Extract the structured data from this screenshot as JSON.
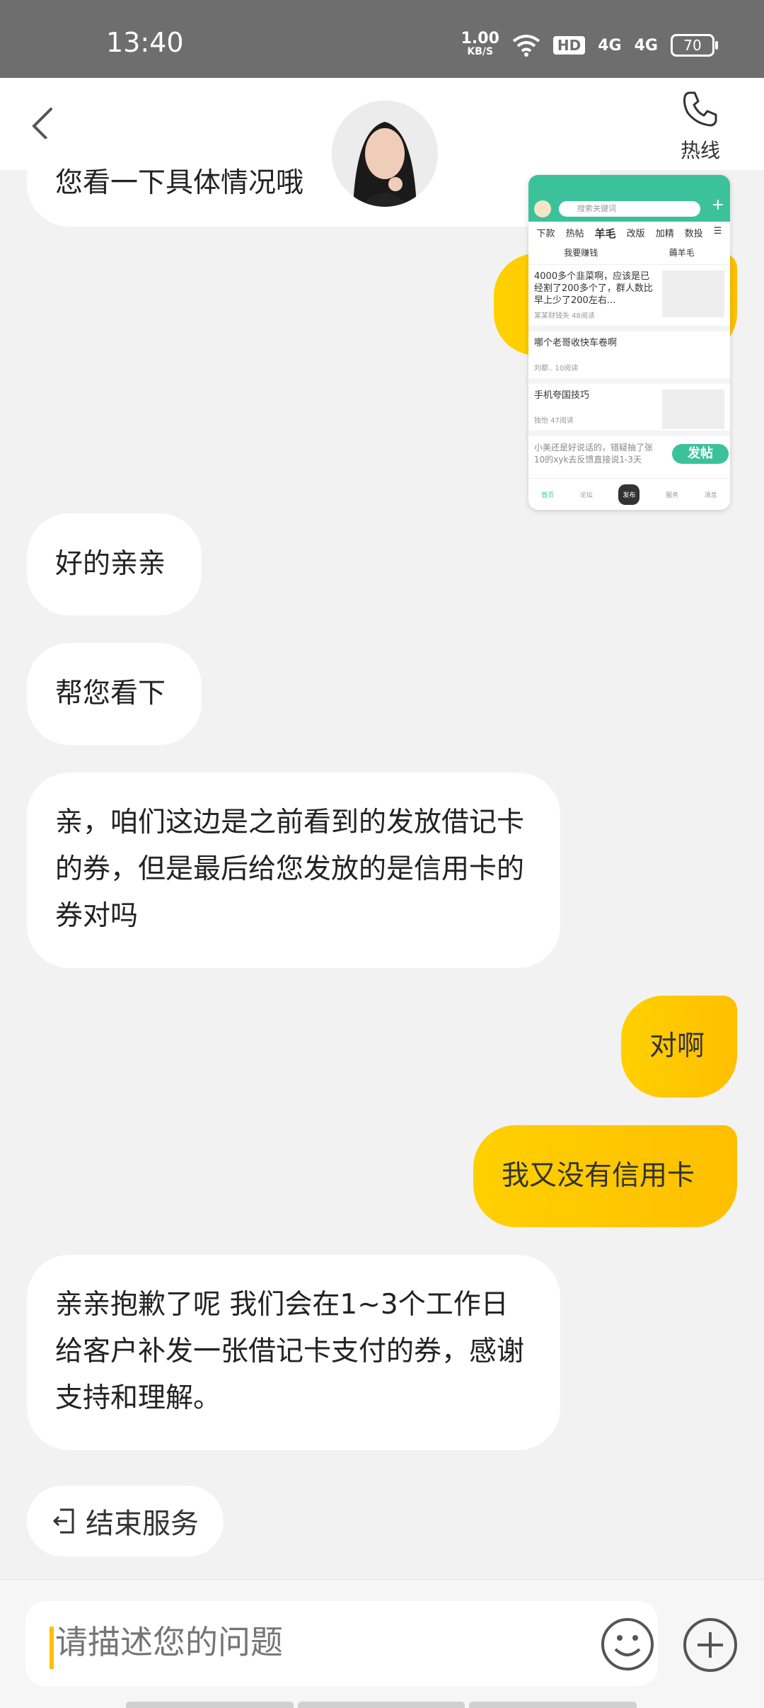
{
  "status_bar": {
    "time": "13:40",
    "net_speed": "1.00",
    "net_unit": "KB/S",
    "hd": "HD",
    "sig1": "4G",
    "sig2": "4G",
    "battery": "70"
  },
  "header": {
    "hotline_label": "热线"
  },
  "messages": [
    {
      "side": "left",
      "text": "您看一下具体情况哦"
    },
    {
      "side": "left",
      "text": "好的亲亲"
    },
    {
      "side": "left",
      "text": "帮您看下"
    },
    {
      "side": "left",
      "text": "亲，咱们这边是之前看到的发放借记卡的券，但是最后给您发放的是信用卡的券对吗"
    },
    {
      "side": "right",
      "text": "对啊"
    },
    {
      "side": "right",
      "text": "我又没有信用卡"
    },
    {
      "side": "left",
      "text": "亲亲抱歉了呢 我们会在1~3个工作日给客户补发一张借记卡支付的券，感谢支持和理解。"
    }
  ],
  "end_service_label": "结束服务",
  "input": {
    "placeholder": "请描述您的问题"
  },
  "mini_window": {
    "search_placeholder": "搜索关键词",
    "tabs": [
      "下款",
      "热帖",
      "羊毛",
      "改版",
      "加精",
      "数投"
    ],
    "sub_tabs": [
      "我要赚钱",
      "薅羊毛"
    ],
    "items": [
      {
        "title": "4000多个韭菜啊，应该是已经割了200多个了，群人数比早上少了200左右...",
        "meta": "某某财钱失 48阅读"
      },
      {
        "title": "哪个老哥收快车卷啊",
        "meta": "刘都.. 10阅读"
      },
      {
        "title": "手机夸国技巧",
        "meta": "独怡 47阅读"
      },
      {
        "title": "小美还是好说话的，错疑抽了张10的xyk去反馈直接说1-3天",
        "meta": ""
      }
    ],
    "fab_label": "发帖",
    "bottom_tabs": [
      "首页",
      "论坛",
      "发布",
      "服务",
      "消息"
    ]
  }
}
